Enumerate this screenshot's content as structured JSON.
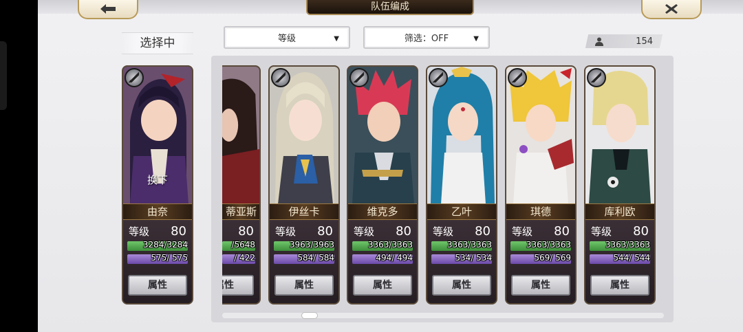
{
  "header": {
    "title": "队伍编成"
  },
  "selected_label": "选择中",
  "sort_dropdown": {
    "value": "等级"
  },
  "filter_dropdown": {
    "value": "筛选：OFF"
  },
  "roster_count": "154",
  "level_label": "等级",
  "attr_label": "属性",
  "selected_character": {
    "name": "由奈",
    "level": "80",
    "hp": "3284/3284",
    "mp": "575/ 575",
    "swap_label": "换下",
    "hp_fraction": 1.0,
    "mp_fraction": 1.0,
    "accent": "#4b2d6b"
  },
  "roster": [
    {
      "name": "蒂亚斯",
      "level": "80",
      "hp": "/5648",
      "mp": "/ 422",
      "accent": "#7a1f22"
    },
    {
      "name": "伊丝卡",
      "level": "80",
      "hp": "3963/3963",
      "mp": "584/ 584",
      "accent": "#b8b4a6"
    },
    {
      "name": "维克多",
      "level": "80",
      "hp": "3363/3363",
      "mp": "494/ 494",
      "accent": "#c23a4a"
    },
    {
      "name": "乙叶",
      "level": "80",
      "hp": "3363/3363",
      "mp": "534/ 534",
      "accent": "#1f8ab0"
    },
    {
      "name": "琪德",
      "level": "80",
      "hp": "3363/3363",
      "mp": "569/ 569",
      "accent": "#e8b934"
    },
    {
      "name": "库利欧",
      "level": "80",
      "hp": "3363/3363",
      "mp": "544/ 544",
      "accent": "#d8c98a"
    }
  ],
  "colors": {
    "hp_bar": "#4fae4b",
    "mp_bar": "#8a67c4",
    "name_plate": "#5a3e22",
    "title_bar": "#2a1d12"
  },
  "icons": {
    "back": "arrow-left-icon",
    "close": "close-x-icon",
    "count": "user-icon",
    "badge": "sword-class-icon"
  }
}
